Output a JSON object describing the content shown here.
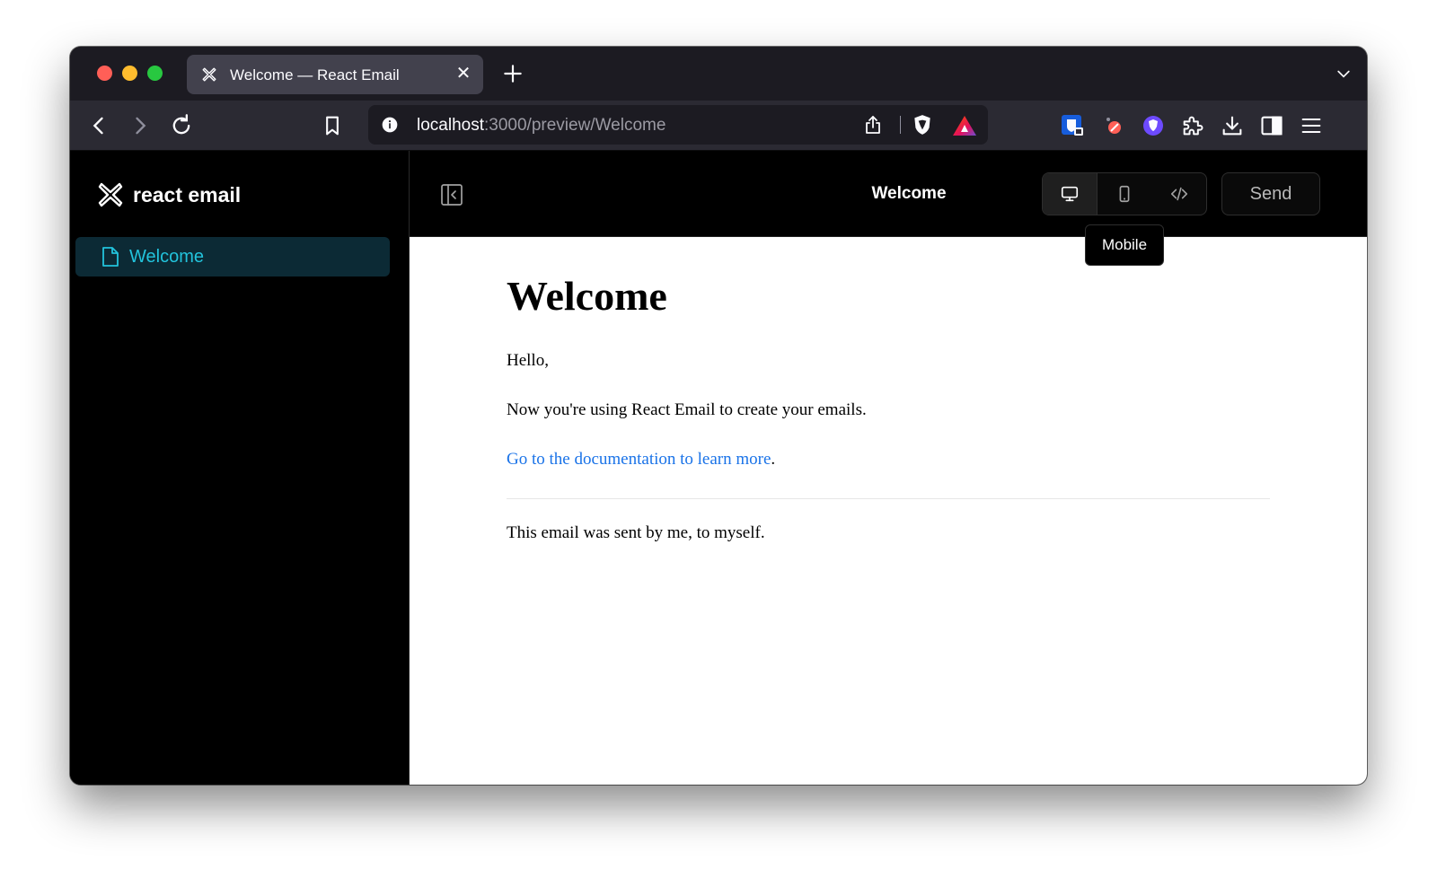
{
  "browser": {
    "tab_title": "Welcome — React Email",
    "tab_close": "✕",
    "url_host": "localhost",
    "url_path": ":3000/preview/Welcome"
  },
  "sidebar": {
    "brand": "react email",
    "items": [
      {
        "label": "Welcome",
        "active": true
      }
    ]
  },
  "header": {
    "title": "Welcome",
    "send_label": "Send",
    "tooltip": "Mobile",
    "views": [
      "desktop",
      "mobile",
      "code"
    ],
    "active_view": "desktop"
  },
  "email": {
    "heading": "Welcome",
    "greeting": "Hello,",
    "body": "Now you're using React Email to create your emails.",
    "link_text": "Go to the documentation to learn more",
    "link_suffix": ".",
    "footer": "This email was sent by me, to myself."
  },
  "colors": {
    "accent": "#22c3dc",
    "link": "#1a73e8",
    "active_item_bg": "#0c2a35"
  }
}
